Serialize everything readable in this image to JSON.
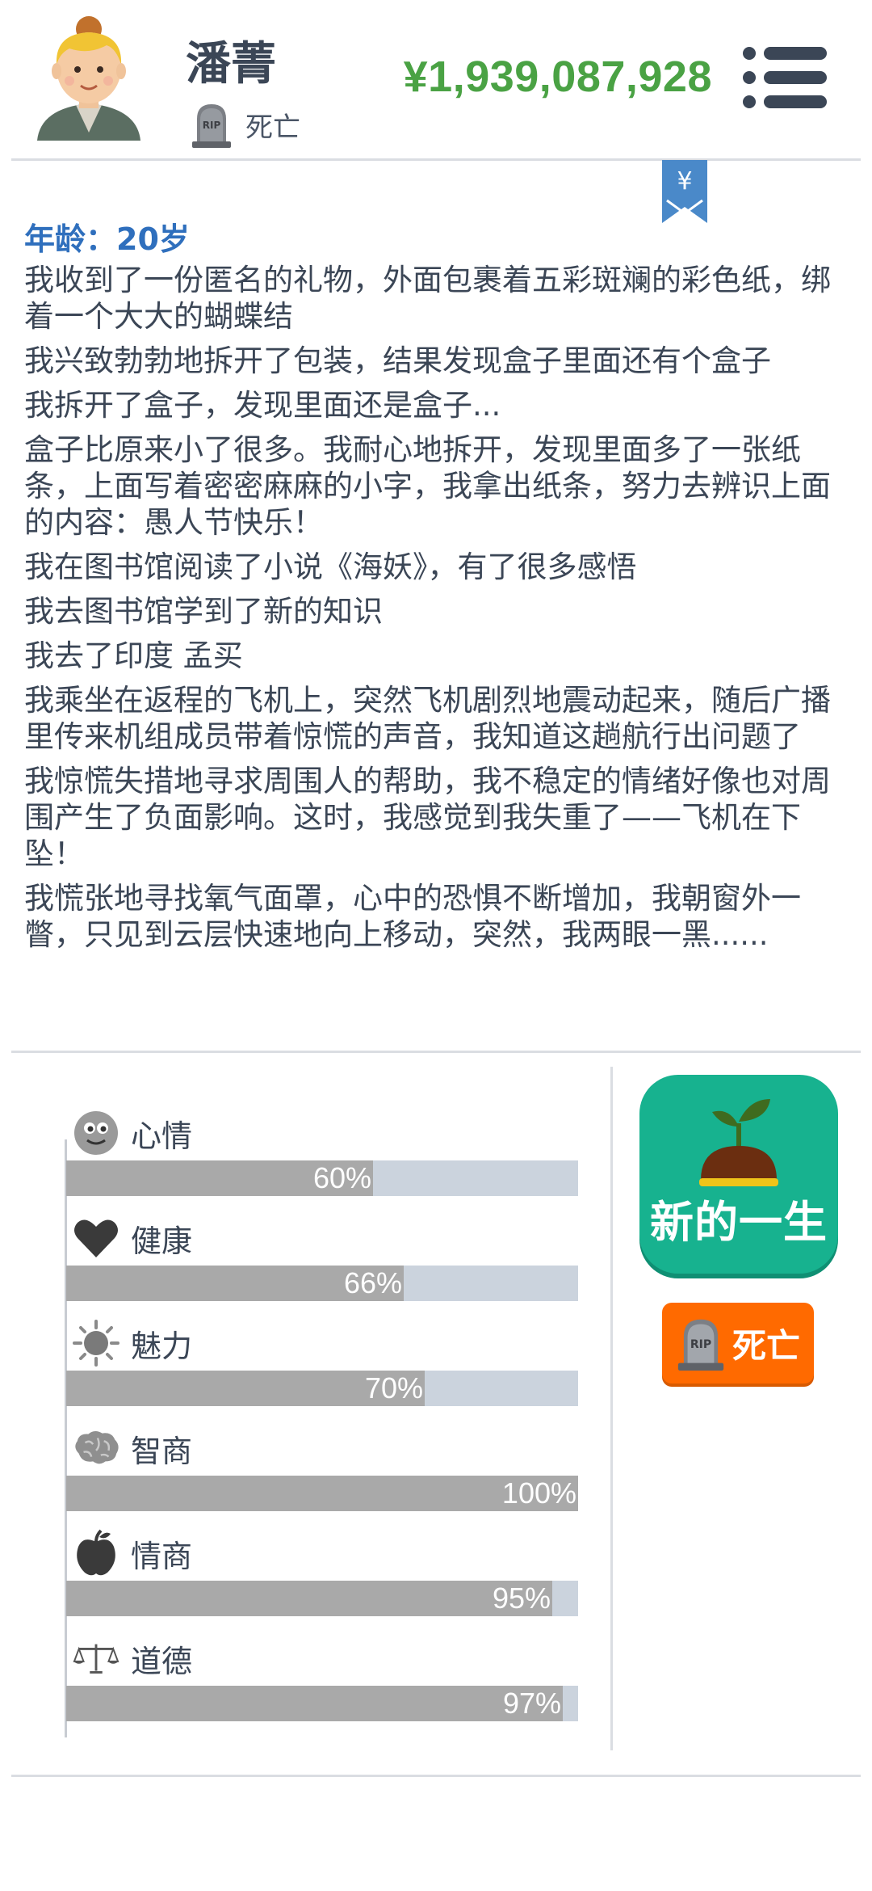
{
  "header": {
    "name": "潘菁",
    "status_label": "死亡",
    "money": "¥1,939,087,928"
  },
  "log": {
    "age_label": "年龄：20岁",
    "entries": [
      "我收到了一份匿名的礼物，外面包裹着五彩斑斓的彩色纸，绑着一个大大的蝴蝶结",
      "我兴致勃勃地拆开了包装，结果发现盒子里面还有个盒子",
      "我拆开了盒子，发现里面还是盒子...",
      "盒子比原来小了很多。我耐心地拆开，发现里面多了一张纸条，上面写着密密麻麻的小字，我拿出纸条，努力去辨识上面的内容：愚人节快乐！",
      "我在图书馆阅读了小说《海妖》，有了很多感悟",
      "我去图书馆学到了新的知识",
      "我去了印度 孟买",
      "我乘坐在返程的飞机上，突然飞机剧烈地震动起来，随后广播里传来机组成员带着惊慌的声音，我知道这趟航行出问题了",
      "我惊慌失措地寻求周围人的帮助，我不稳定的情绪好像也对周围产生了负面影响。这时，我感觉到我失重了——飞机在下坠！",
      "我慌张地寻找氧气面罩，心中的恐惧不断增加，我朝窗外一瞥，只见到云层快速地向上移动，突然，我两眼一黑......"
    ]
  },
  "bookmark": {
    "symbol": "¥"
  },
  "stats": [
    {
      "label": "心情",
      "value": 60,
      "text": "60%",
      "icon": "smiley-icon"
    },
    {
      "label": "健康",
      "value": 66,
      "text": "66%",
      "icon": "heart-icon"
    },
    {
      "label": "魅力",
      "value": 70,
      "text": "70%",
      "icon": "sun-icon"
    },
    {
      "label": "智商",
      "value": 100,
      "text": "100%",
      "icon": "brain-icon"
    },
    {
      "label": "情商",
      "value": 95,
      "text": "95%",
      "icon": "apple-icon"
    },
    {
      "label": "道德",
      "value": 97,
      "text": "97%",
      "icon": "scales-icon"
    }
  ],
  "buttons": {
    "new_life": "新的一生",
    "die": "死亡"
  },
  "colors": {
    "money": "#4aa244",
    "age": "#2f6fbd",
    "new_life_bg": "#17b28f",
    "die_bg": "#ff6a00",
    "bar_fill": "#a9a9a9",
    "bar_track": "#cbd3dd",
    "bookmark": "#4a89c9"
  }
}
